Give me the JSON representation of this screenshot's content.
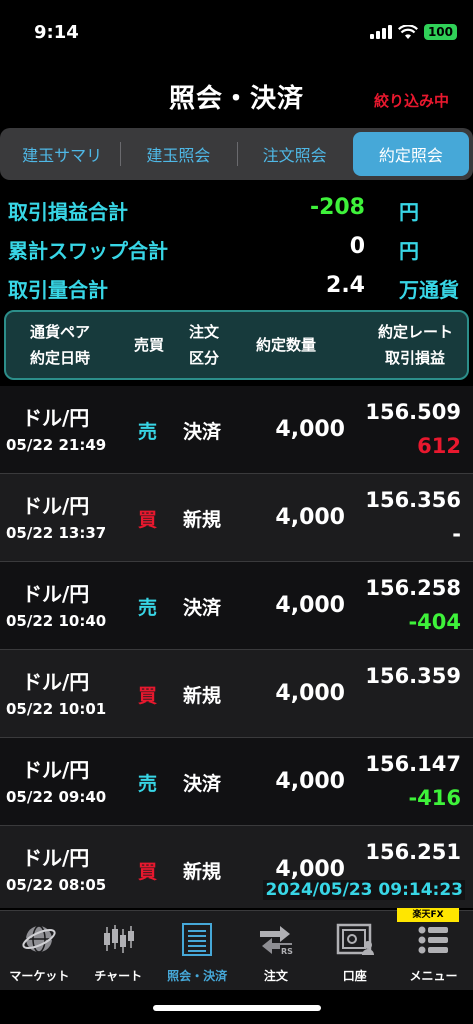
{
  "status_bar": {
    "time": "9:14",
    "battery": "100"
  },
  "header": {
    "title": "照会・決済",
    "filter_label": "絞り込み中"
  },
  "tabs": [
    {
      "label": "建玉サマリ",
      "active": false
    },
    {
      "label": "建玉照会",
      "active": false
    },
    {
      "label": "注文照会",
      "active": false
    },
    {
      "label": "約定照会",
      "active": true
    }
  ],
  "summary": {
    "profit_total": {
      "label": "取引損益合計",
      "value": "-208",
      "unit": "円"
    },
    "swap_total": {
      "label": "累計スワップ合計",
      "value": "0",
      "unit": "円"
    },
    "volume_total": {
      "label": "取引量合計",
      "value": "2.4",
      "unit": "万通貨"
    }
  },
  "columns": {
    "pair": "通貨ペア",
    "datetime": "約定日時",
    "side": "売買",
    "order_kind_1": "注文",
    "order_kind_2": "区分",
    "quantity": "約定数量",
    "rate": "約定レート",
    "pl": "取引損益"
  },
  "rows": [
    {
      "pair": "ドル/円",
      "datetime": "05/22 21:49",
      "side": "売",
      "side_type": "sell",
      "kind": "決済",
      "quantity": "4,000",
      "rate": "156.509",
      "pl": "612",
      "pl_type": "pos"
    },
    {
      "pair": "ドル/円",
      "datetime": "05/22 13:37",
      "side": "買",
      "side_type": "buy",
      "kind": "新規",
      "quantity": "4,000",
      "rate": "156.356",
      "pl": "-",
      "pl_type": "none"
    },
    {
      "pair": "ドル/円",
      "datetime": "05/22 10:40",
      "side": "売",
      "side_type": "sell",
      "kind": "決済",
      "quantity": "4,000",
      "rate": "156.258",
      "pl": "-404",
      "pl_type": "neg"
    },
    {
      "pair": "ドル/円",
      "datetime": "05/22 10:01",
      "side": "買",
      "side_type": "buy",
      "kind": "新規",
      "quantity": "4,000",
      "rate": "156.359",
      "pl": "",
      "pl_type": "none"
    },
    {
      "pair": "ドル/円",
      "datetime": "05/22 09:40",
      "side": "売",
      "side_type": "sell",
      "kind": "決済",
      "quantity": "4,000",
      "rate": "156.147",
      "pl": "-416",
      "pl_type": "neg"
    },
    {
      "pair": "ドル/円",
      "datetime": "05/22 08:05",
      "side": "買",
      "side_type": "buy",
      "kind": "新規",
      "quantity": "4,000",
      "rate": "156.251",
      "pl": "",
      "pl_type": "none"
    }
  ],
  "timestamp": "2024/05/23 09:14:23",
  "brand": "楽天FX",
  "bottom_nav": [
    {
      "label": "マーケット",
      "icon": "globe-icon",
      "active": false
    },
    {
      "label": "チャート",
      "icon": "candlestick-icon",
      "active": false
    },
    {
      "label": "照会・決済",
      "icon": "document-icon",
      "active": true
    },
    {
      "label": "注文",
      "icon": "order-icon",
      "active": false
    },
    {
      "label": "口座",
      "icon": "account-safe-icon",
      "active": false
    },
    {
      "label": "メニュー",
      "icon": "menu-icon",
      "active": false
    }
  ],
  "colors": {
    "accent_cyan": "#38d6e6",
    "tab_active": "#46a8d8",
    "profit_red": "#e8182e",
    "loss_green": "#3ef23a"
  }
}
